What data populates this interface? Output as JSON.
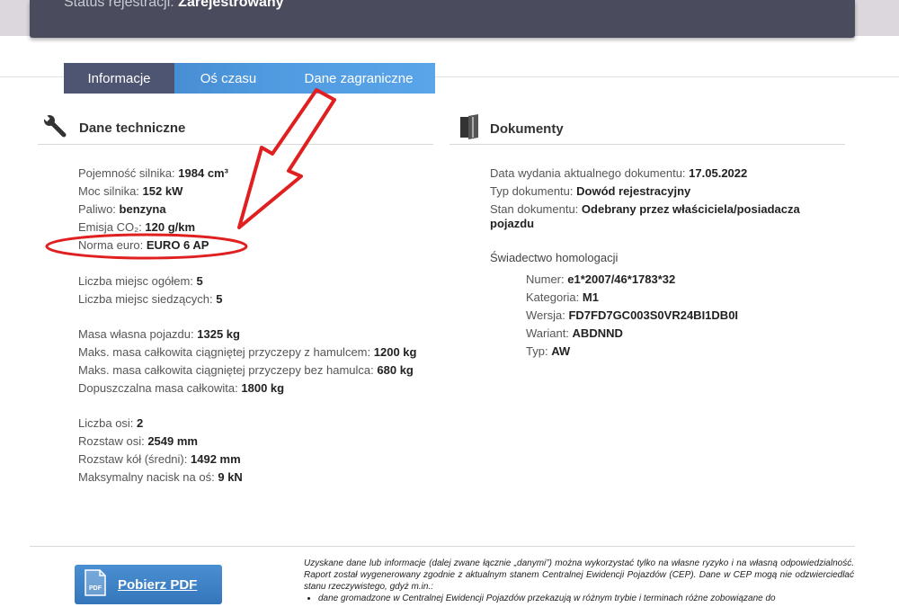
{
  "status": {
    "label": "Status rejestracji:",
    "value": "Zarejestrowany"
  },
  "tabs": [
    {
      "label": "Informacje",
      "active": true
    },
    {
      "label": "Oś czasu",
      "active": false
    },
    {
      "label": "Dane zagraniczne",
      "active": false
    }
  ],
  "technical": {
    "title": "Dane techniczne",
    "icon": "wrench-icon",
    "engine_capacity": {
      "label": "Pojemność silnika:",
      "value": "1984 cm³"
    },
    "engine_power": {
      "label": "Moc silnika:",
      "value": "152 kW"
    },
    "fuel": {
      "label": "Paliwo:",
      "value": "benzyna"
    },
    "co2": {
      "label": "Emisja CO₂:",
      "value": "120 g/km"
    },
    "euro_norm": {
      "label": "Norma euro:",
      "value": "EURO 6 AP"
    },
    "seats_total": {
      "label": "Liczba miejsc ogółem:",
      "value": "5"
    },
    "seats_sitting": {
      "label": "Liczba miejsc siedzących:",
      "value": "5"
    },
    "curb_weight": {
      "label": "Masa własna pojazdu:",
      "value": "1325 kg"
    },
    "trailer_braked": {
      "label": "Maks. masa całkowita ciągniętej przyczepy z hamulcem:",
      "value": "1200 kg"
    },
    "trailer_unbraked": {
      "label": "Maks. masa całkowita ciągniętej przyczepy bez hamulca:",
      "value": "680 kg"
    },
    "gross_weight": {
      "label": "Dopuszczalna masa całkowita:",
      "value": "1800 kg"
    },
    "axles": {
      "label": "Liczba osi:",
      "value": "2"
    },
    "wheelbase": {
      "label": "Rozstaw osi:",
      "value": "2549 mm"
    },
    "track": {
      "label": "Rozstaw kół (średni):",
      "value": "1492 mm"
    },
    "axle_load": {
      "label": "Maksymalny nacisk na oś:",
      "value": "9 kN"
    }
  },
  "documents": {
    "title": "Dokumenty",
    "icon": "document-icon",
    "issue_date": {
      "label": "Data wydania aktualnego dokumentu:",
      "value": "17.05.2022"
    },
    "doc_type": {
      "label": "Typ dokumentu:",
      "value": "Dowód rejestracyjny"
    },
    "doc_state": {
      "label": "Stan dokumentu:",
      "value": "Odebrany przez właściciela/posiadacza pojazdu"
    },
    "homologation": {
      "title": "Świadectwo homologacji",
      "number": {
        "label": "Numer:",
        "value": "e1*2007/46*1783*32"
      },
      "category": {
        "label": "Kategoria:",
        "value": "M1"
      },
      "version": {
        "label": "Wersja:",
        "value": "FD7FD7GC003S0VR24BI1DB0I"
      },
      "variant": {
        "label": "Wariant:",
        "value": "ABDNND"
      },
      "type": {
        "label": "Typ:",
        "value": "AW"
      }
    }
  },
  "pdf_button": {
    "label": "Pobierz PDF",
    "icon_text": "PDF"
  },
  "disclaimer": {
    "p1": "Uzyskane dane lub informacje (dalej zwane łącznie „danymi”) można wykorzystać tylko na własne ryzyko i na własną odpowiedzialność. Raport został wygenerowany zgodnie z aktualnym stanem Centralnej Ewidencji Pojazdów (CEP). Dane w CEP mogą nie odzwierciedlać stanu rzeczywistego, gdyż m.in.:",
    "bullet1": "dane gromadzone w Centralnej Ewidencji Pojazdów przekazują w różnym trybie i terminach różne zobowiązane do"
  },
  "colors": {
    "header_bg": "#4a4c5e",
    "tab_active": "#4d5573",
    "tab_bg": "#4f9ae0",
    "annotation_red": "#e02020"
  }
}
